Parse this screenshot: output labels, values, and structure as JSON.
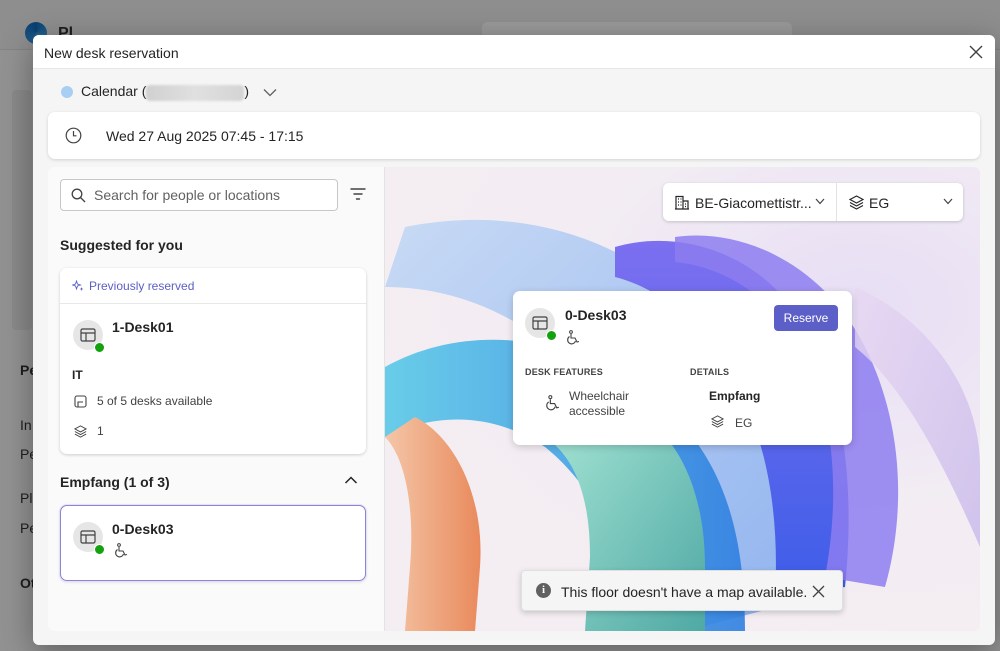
{
  "background": {
    "app_title": "Pl",
    "side_items": [
      "Pe",
      "In",
      "Pe",
      "Pl",
      "Pe",
      "Ot"
    ]
  },
  "dialog": {
    "title": "New desk reservation",
    "calendar": {
      "label": "Calendar (",
      "suffix": ")"
    },
    "datetime": "Wed 27 Aug 2025 07:45 - 17:15"
  },
  "left_panel": {
    "search_placeholder": "Search for people or locations",
    "suggested_title": "Suggested for you",
    "suggested_card": {
      "badge": "Previously reserved",
      "desk_name": "1-Desk01",
      "neighborhood": "IT",
      "availability": "5 of 5 desks available",
      "floor": "1"
    },
    "group": {
      "title": "Empfang (1 of 3)",
      "desk_name": "0-Desk03"
    }
  },
  "map": {
    "building": "BE-Giacomettistr...",
    "floor": "EG",
    "detail": {
      "desk_name": "0-Desk03",
      "reserve_label": "Reserve",
      "features_title": "DESK FEATURES",
      "feature": "Wheelchair accessible",
      "feature_line1": "Wheelchair",
      "feature_line2": "accessible",
      "details_title": "DETAILS",
      "location": "Empfang",
      "floor": "EG"
    },
    "toast": "This floor doesn't have a map available."
  },
  "colors": {
    "accent": "#5b5fc7",
    "available": "#13a10e",
    "calendar_dot": "#a8cff3"
  }
}
